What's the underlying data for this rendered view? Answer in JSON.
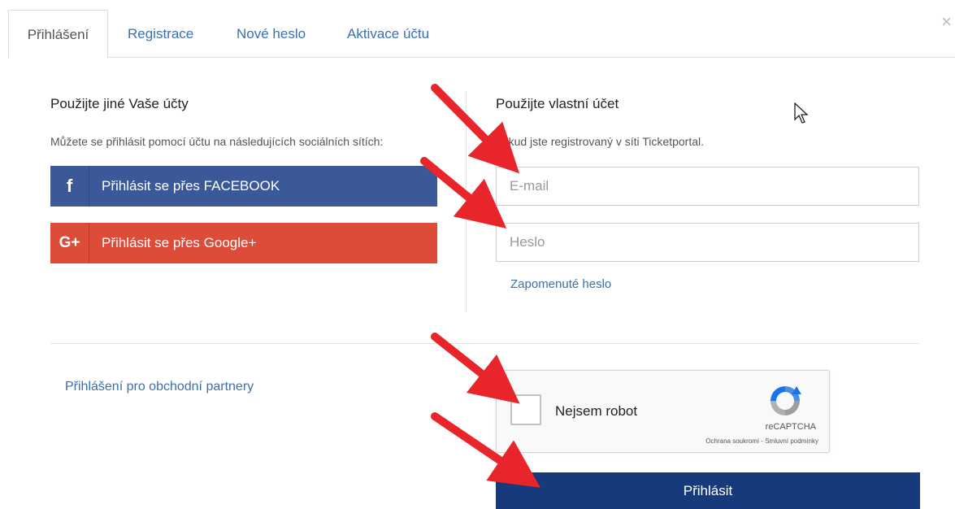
{
  "tabs": [
    {
      "label": "Přihlášení",
      "active": true
    },
    {
      "label": "Registrace",
      "active": false
    },
    {
      "label": "Nové heslo",
      "active": false
    },
    {
      "label": "Aktivace účtu",
      "active": false
    }
  ],
  "close_icon": "×",
  "left": {
    "title": "Použijte jiné Vaše účty",
    "subtitle": "Můžete se přihlásit pomocí účtu na následujících sociálních sítích:",
    "facebook": {
      "icon": "f",
      "label": "Přihlásit se přes FACEBOOK",
      "color": "#3b5998"
    },
    "google": {
      "icon": "G+",
      "label": "Přihlásit se přes Google+",
      "color": "#dd4b39"
    }
  },
  "right": {
    "title": "Použijte vlastní účet",
    "subtitle": "pokud jste registrovaný v síti Ticketportal.",
    "email_placeholder": "E-mail",
    "password_placeholder": "Heslo",
    "forgot_link": "Zapomenuté heslo"
  },
  "partners_link": "Přihlášení pro obchodní partnery",
  "recaptcha": {
    "label": "Nejsem robot",
    "brand": "reCAPTCHA",
    "terms": "Ochrana soukromí - Smluvní podmínky"
  },
  "submit_label": "Přihlásit",
  "colors": {
    "accent": "#3a6fb0",
    "submit": "#173a7c",
    "arrow": "#e8252b"
  }
}
